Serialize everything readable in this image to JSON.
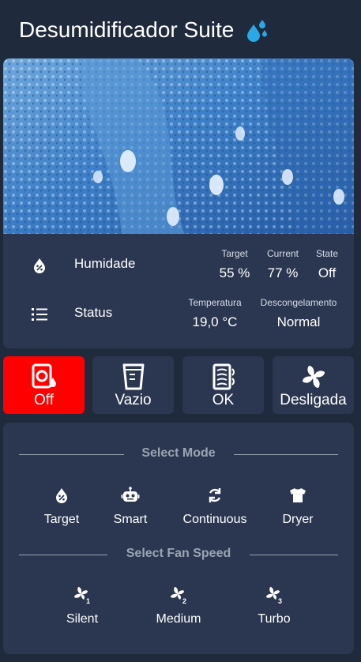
{
  "header": {
    "title": "Desumidificador Suite",
    "icon": "water-drops-icon",
    "icon_color": "#2aa8e6"
  },
  "humidity": {
    "label": "Humidade",
    "icon": "humidity-drop-icon",
    "target_label": "Target",
    "target_value": "55 %",
    "current_label": "Current",
    "current_value": "77 %",
    "state_label": "State",
    "state_value": "Off"
  },
  "status": {
    "label": "Status",
    "icon": "list-icon",
    "temp_label": "Temperatura",
    "temp_value": "19,0 °C",
    "defrost_label": "Descongelamento",
    "defrost_value": "Normal"
  },
  "tiles": [
    {
      "label": "Off",
      "icon": "dehumidifier-power-icon",
      "active": true,
      "color": "#ff0000"
    },
    {
      "label": "Vazio",
      "icon": "water-tank-icon",
      "active": false
    },
    {
      "label": "OK",
      "icon": "air-filter-icon",
      "active": false
    },
    {
      "label": "Desligada",
      "icon": "fan-icon",
      "active": false
    }
  ],
  "modes": {
    "title": "Select Mode",
    "items": [
      {
        "label": "Target",
        "icon": "humidity-drop-icon"
      },
      {
        "label": "Smart",
        "icon": "robot-icon"
      },
      {
        "label": "Continuous",
        "icon": "cycle-icon"
      },
      {
        "label": "Dryer",
        "icon": "shirt-icon"
      }
    ]
  },
  "fan": {
    "title": "Select Fan Speed",
    "items": [
      {
        "label": "Silent",
        "icon": "fan-speed-1-icon"
      },
      {
        "label": "Medium",
        "icon": "fan-speed-2-icon"
      },
      {
        "label": "Turbo",
        "icon": "fan-speed-3-icon"
      }
    ]
  },
  "colors": {
    "background": "#202a3d",
    "card": "#2b3750",
    "active": "#ff0000",
    "muted": "#9aa4b3"
  }
}
